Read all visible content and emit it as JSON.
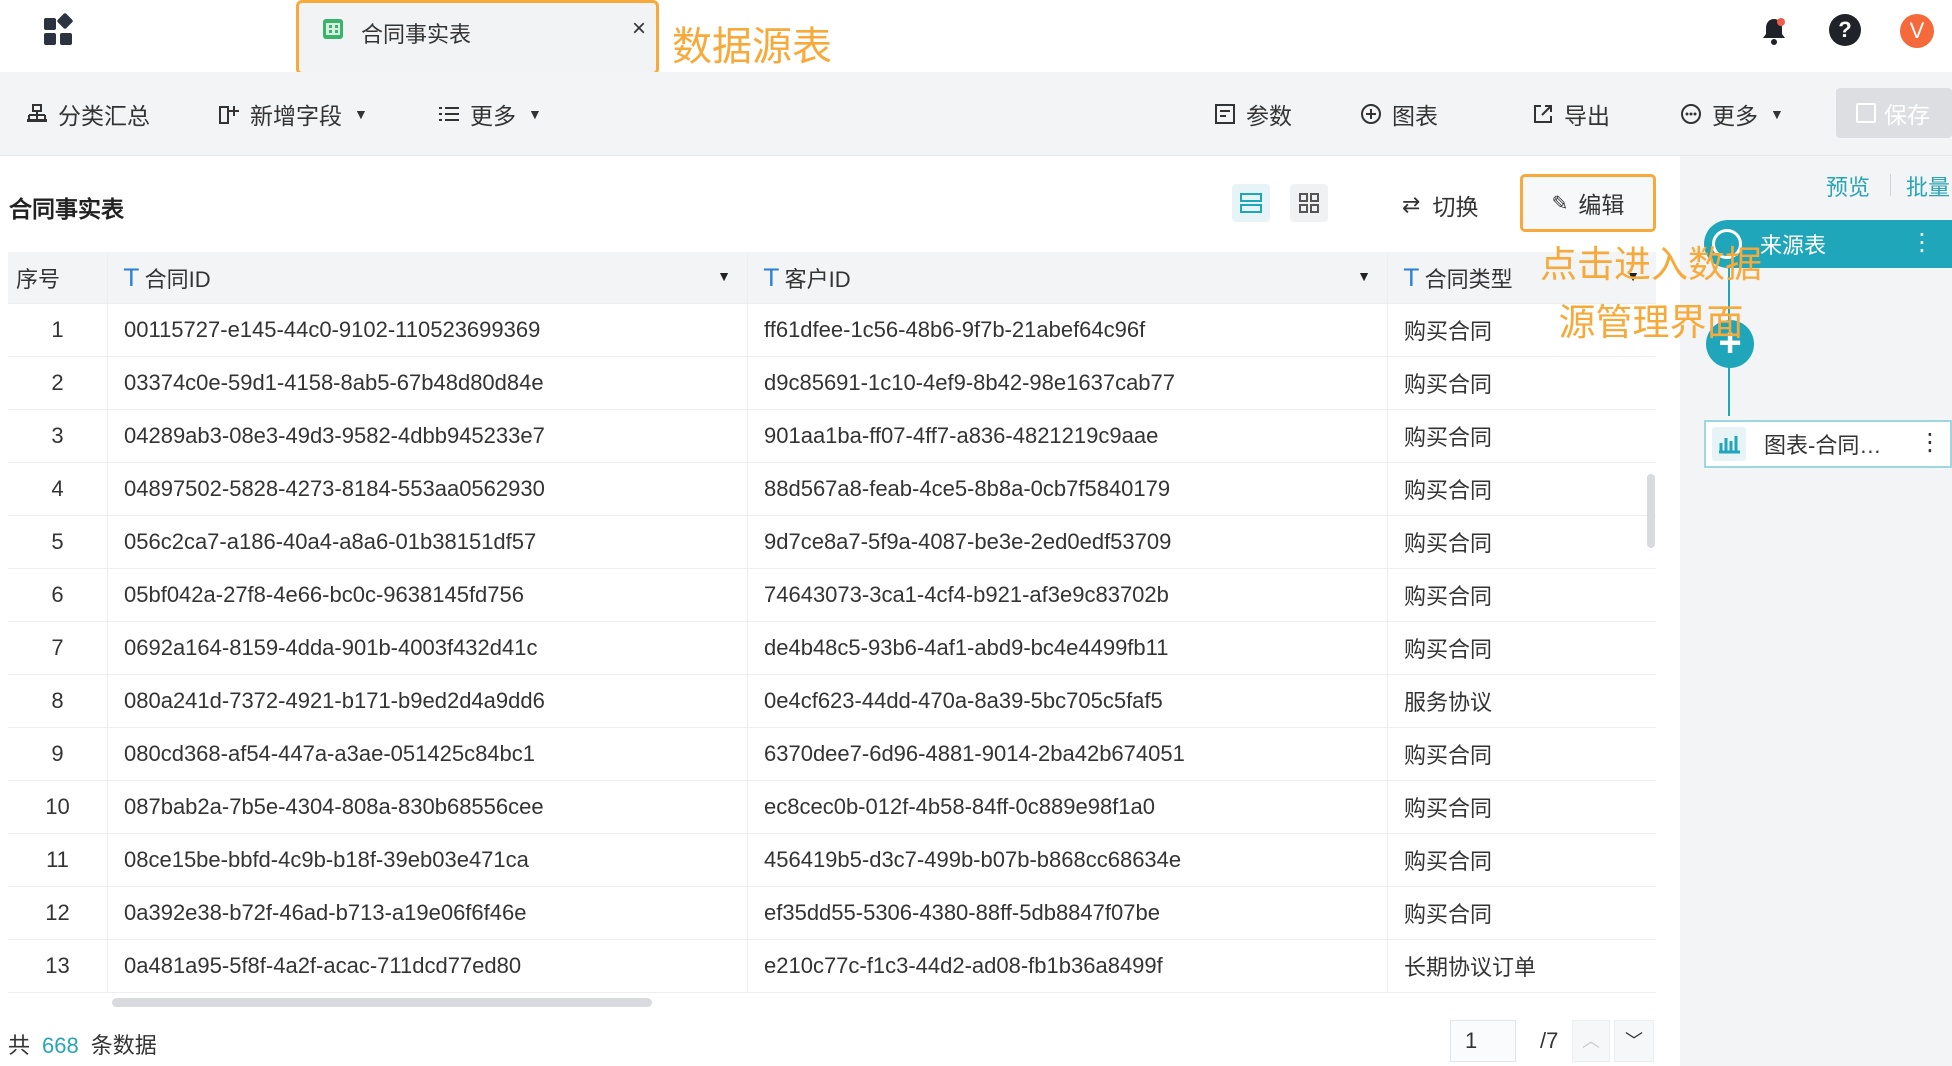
{
  "tab": {
    "title": "合同事实表",
    "close": "×"
  },
  "annotations": {
    "source_table": "数据源表",
    "edit_hint": "点击进入数据源管理界面"
  },
  "user": {
    "avatar_letter": "V"
  },
  "toolbar": {
    "group_summary": "分类汇总",
    "add_field": "新增字段",
    "more_left": "更多",
    "params": "参数",
    "chart": "图表",
    "export": "导出",
    "more_right": "更多",
    "save": "保存"
  },
  "main": {
    "title": "合同事实表",
    "switch": "切换",
    "edit": "编辑"
  },
  "table": {
    "columns": [
      "序号",
      "合同ID",
      "客户ID",
      "合同类型"
    ],
    "rows": [
      [
        "1",
        "00115727-e145-44c0-9102-110523699369",
        "ff61dfee-1c56-48b6-9f7b-21abef64c96f",
        "购买合同"
      ],
      [
        "2",
        "03374c0e-59d1-4158-8ab5-67b48d80d84e",
        "d9c85691-1c10-4ef9-8b42-98e1637cab77",
        "购买合同"
      ],
      [
        "3",
        "04289ab3-08e3-49d3-9582-4dbb945233e7",
        "901aa1ba-ff07-4ff7-a836-4821219c9aae",
        "购买合同"
      ],
      [
        "4",
        "04897502-5828-4273-8184-553aa0562930",
        "88d567a8-feab-4ce5-8b8a-0cb7f5840179",
        "购买合同"
      ],
      [
        "5",
        "056c2ca7-a186-40a4-a8a6-01b38151df57",
        "9d7ce8a7-5f9a-4087-be3e-2ed0edf53709",
        "购买合同"
      ],
      [
        "6",
        "05bf042a-27f8-4e66-bc0c-9638145fd756",
        "74643073-3ca1-4cf4-b921-af3e9c83702b",
        "购买合同"
      ],
      [
        "7",
        "0692a164-8159-4dda-901b-4003f432d41c",
        "de4b48c5-93b6-4af1-abd9-bc4e4499fb11",
        "购买合同"
      ],
      [
        "8",
        "080a241d-7372-4921-b171-b9ed2d4a9dd6",
        "0e4cf623-44dd-470a-8a39-5bc705c5faf5",
        "服务协议"
      ],
      [
        "9",
        "080cd368-af54-447a-a3ae-051425c84bc1",
        "6370dee7-6d96-4881-9014-2ba42b674051",
        "购买合同"
      ],
      [
        "10",
        "087bab2a-7b5e-4304-808a-830b68556cee",
        "ec8cec0b-012f-4b58-84ff-0c889e98f1a0",
        "购买合同"
      ],
      [
        "11",
        "08ce15be-bbfd-4c9b-b18f-39eb03e471ca",
        "456419b5-d3c7-499b-b07b-b868cc68634e",
        "购买合同"
      ],
      [
        "12",
        "0a392e38-b72f-46ad-b713-a19e06f6f46e",
        "ef35dd55-5306-4380-88ff-5db8847f07be",
        "购买合同"
      ],
      [
        "13",
        "0a481a95-5f8f-4a2f-acac-711dcd77ed80",
        "e210c77c-f1c3-44d2-ad08-fb1b36a8499f",
        "长期协议订单"
      ]
    ]
  },
  "footer": {
    "prefix": "共",
    "count": "668",
    "suffix": "条数据",
    "page": "1",
    "total_pages": "/7"
  },
  "right_panel": {
    "preview": "预览",
    "batch": "批量",
    "source_node": "来源表",
    "chart_node": "图表-合同…"
  },
  "colors": {
    "accent": "#1fa6ba",
    "highlight": "#f7a93a",
    "avatar": "#f5693a"
  }
}
